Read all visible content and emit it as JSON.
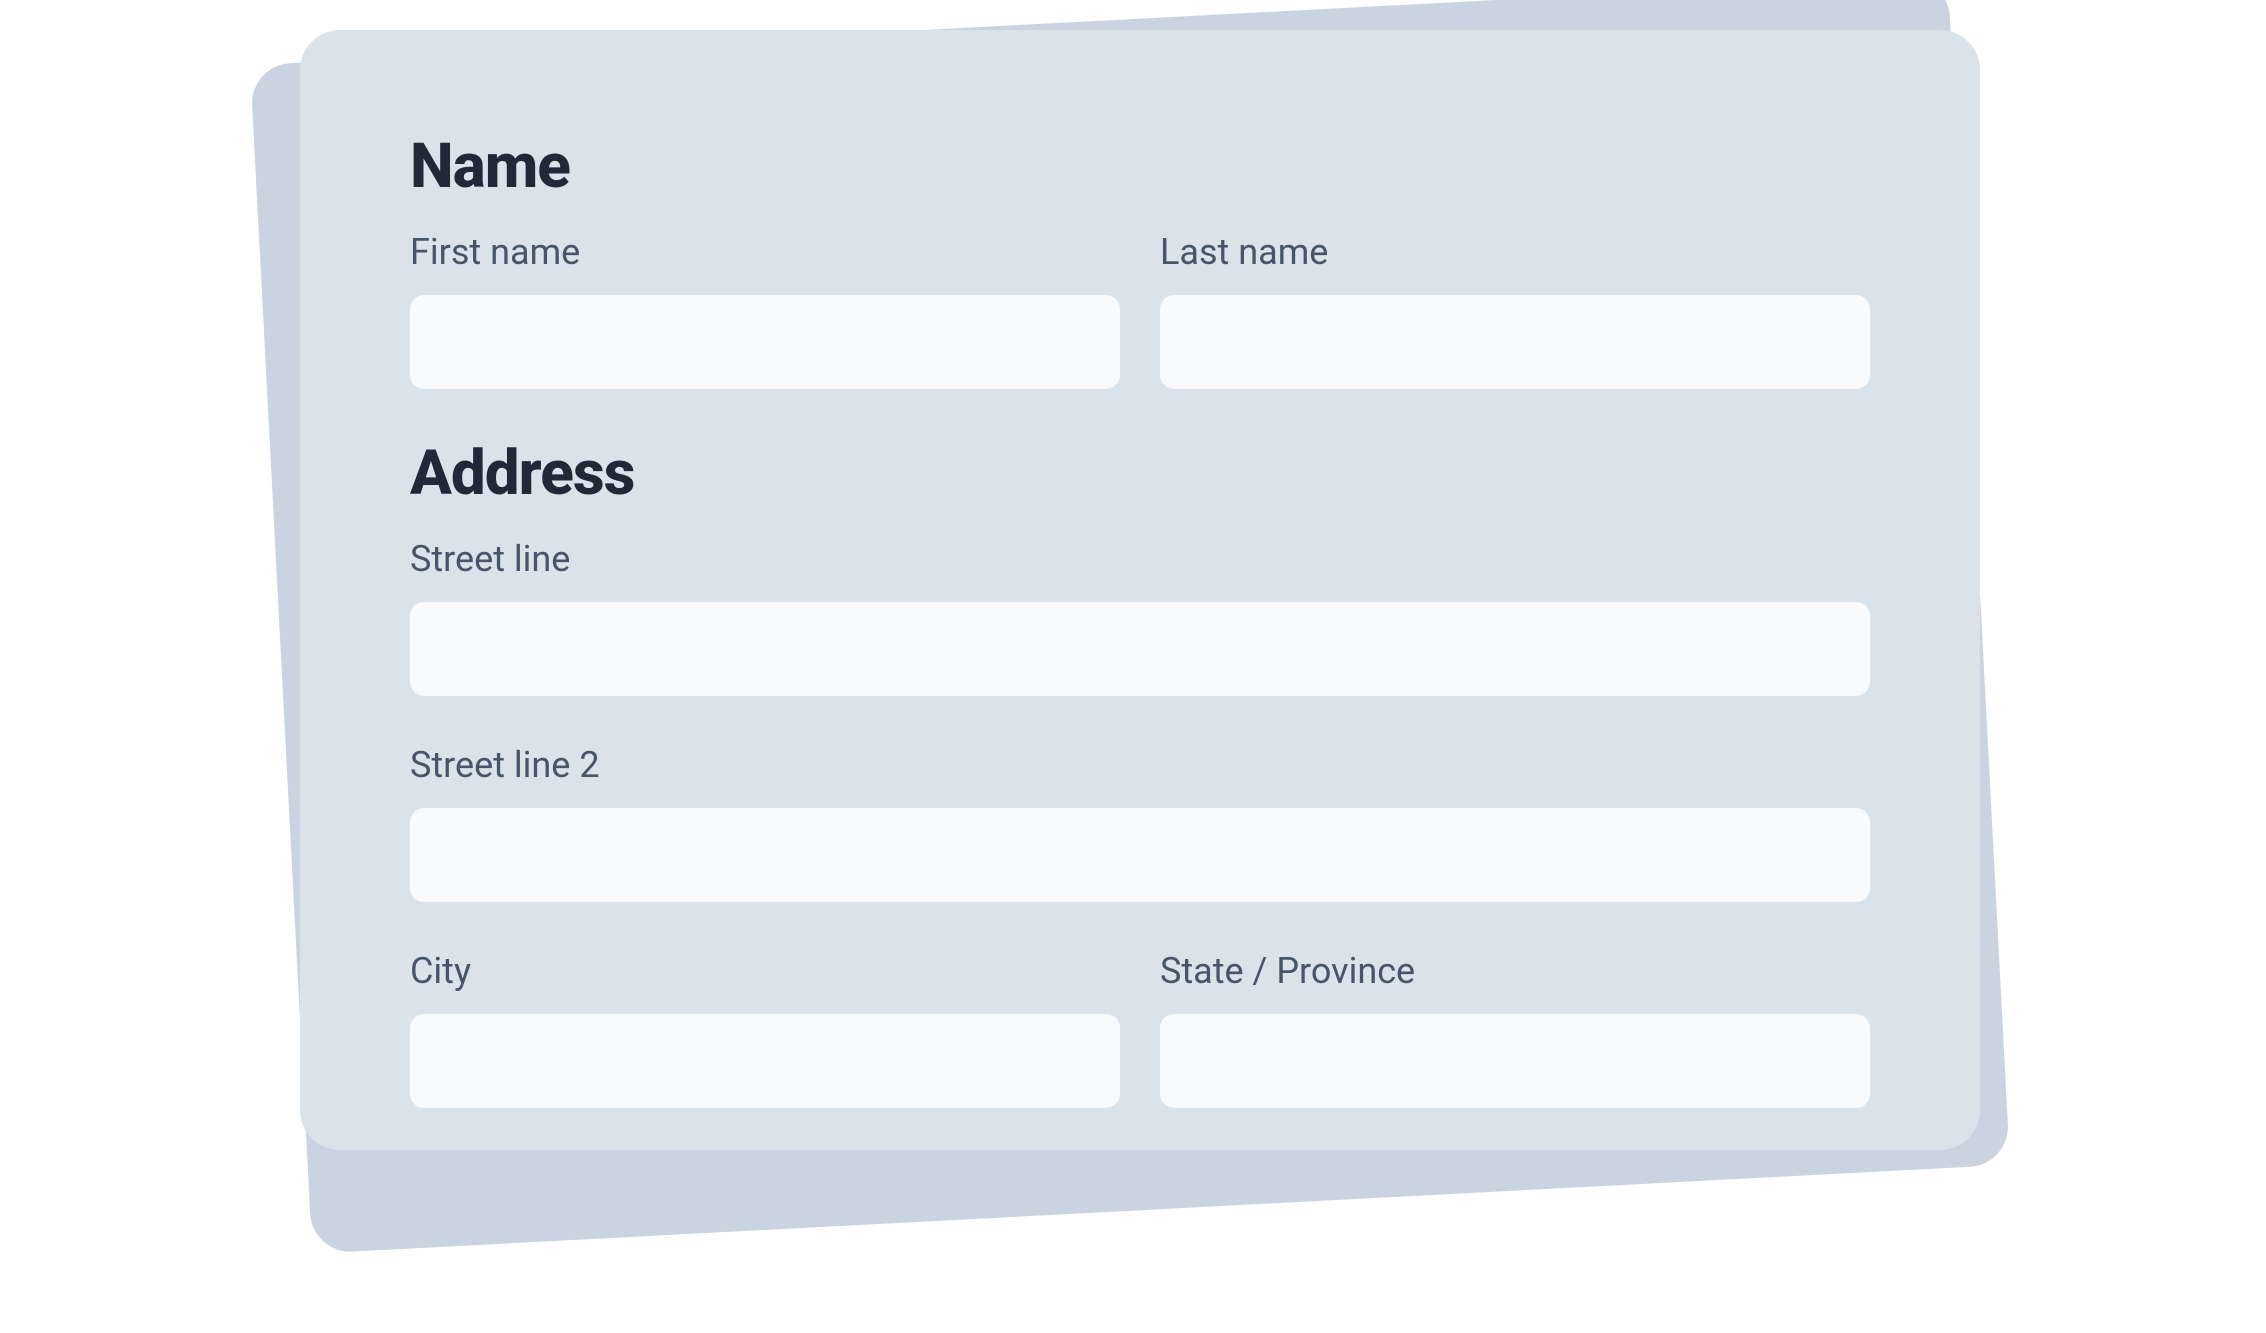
{
  "sections": {
    "name": {
      "heading": "Name",
      "fields": {
        "first_name": {
          "label": "First name",
          "value": ""
        },
        "last_name": {
          "label": "Last name",
          "value": ""
        }
      }
    },
    "address": {
      "heading": "Address",
      "fields": {
        "street_line": {
          "label": "Street line",
          "value": ""
        },
        "street_line_2": {
          "label": "Street line 2",
          "value": ""
        },
        "city": {
          "label": "City",
          "value": ""
        },
        "state": {
          "label": "State / Province",
          "value": ""
        }
      }
    }
  }
}
